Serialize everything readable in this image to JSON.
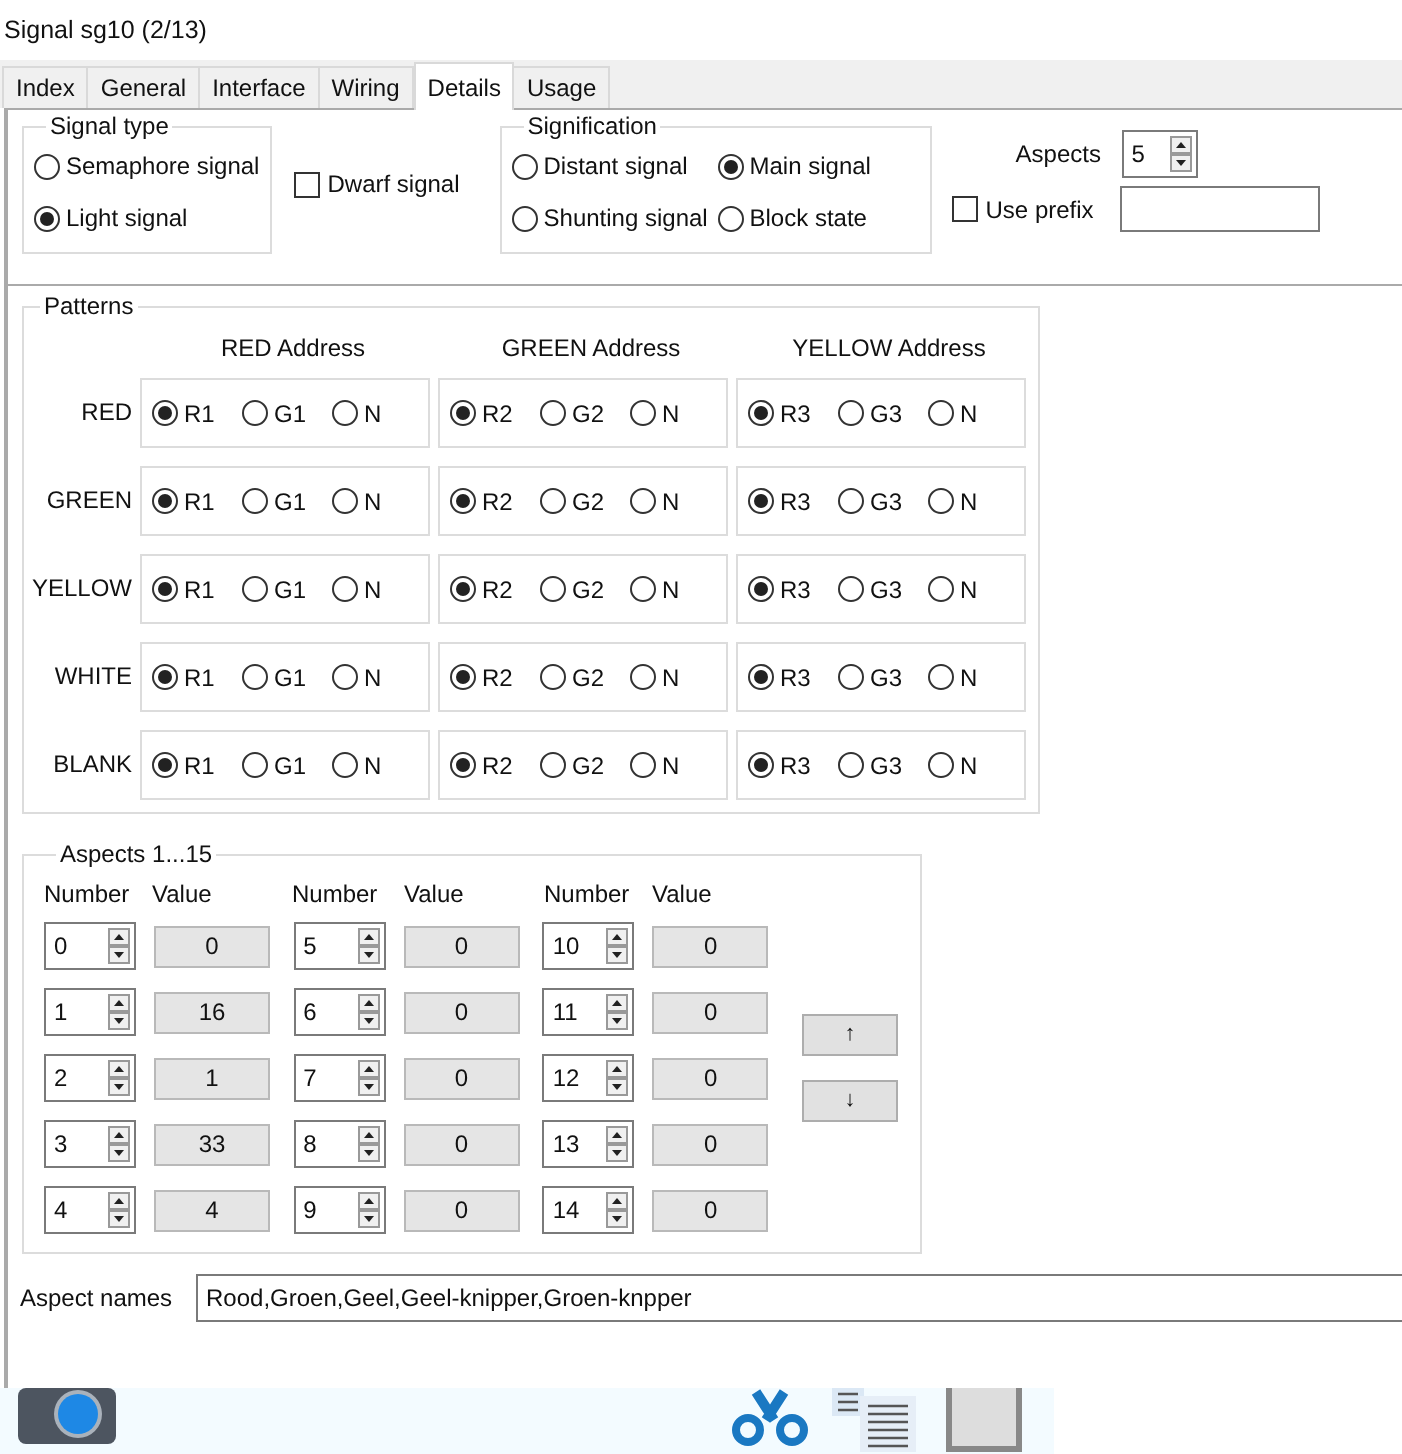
{
  "window": {
    "title": "Signal sg10 (2/13)"
  },
  "tabs": [
    {
      "label": "Index",
      "selected": false
    },
    {
      "label": "General",
      "selected": false
    },
    {
      "label": "Interface",
      "selected": false
    },
    {
      "label": "Wiring",
      "selected": false
    },
    {
      "label": "Details",
      "selected": true
    },
    {
      "label": "Usage",
      "selected": false
    }
  ],
  "signal_type": {
    "title": "Signal type",
    "options": [
      {
        "label": "Semaphore signal",
        "selected": false
      },
      {
        "label": "Light signal",
        "selected": true
      }
    ]
  },
  "dwarf_signal": {
    "label": "Dwarf signal",
    "checked": false
  },
  "signification": {
    "title": "Signification",
    "options": [
      {
        "label": "Distant signal",
        "selected": false
      },
      {
        "label": "Main signal",
        "selected": true
      },
      {
        "label": "Shunting signal",
        "selected": false
      },
      {
        "label": "Block state",
        "selected": false
      }
    ]
  },
  "aspects": {
    "label": "Aspects",
    "value": "5"
  },
  "use_prefix": {
    "label": "Use prefix",
    "checked": false
  },
  "patterns": {
    "title": "Patterns",
    "columns": [
      "RED Address",
      "GREEN Address",
      "YELLOW Address"
    ],
    "rows": [
      {
        "label": "RED",
        "cells": [
          [
            {
              "label": "R1",
              "selected": true
            },
            {
              "label": "G1",
              "selected": false
            },
            {
              "label": "N",
              "selected": false
            }
          ],
          [
            {
              "label": "R2",
              "selected": true
            },
            {
              "label": "G2",
              "selected": false
            },
            {
              "label": "N",
              "selected": false
            }
          ],
          [
            {
              "label": "R3",
              "selected": true
            },
            {
              "label": "G3",
              "selected": false
            },
            {
              "label": "N",
              "selected": false
            }
          ]
        ]
      },
      {
        "label": "GREEN",
        "cells": [
          [
            {
              "label": "R1",
              "selected": true
            },
            {
              "label": "G1",
              "selected": false
            },
            {
              "label": "N",
              "selected": false
            }
          ],
          [
            {
              "label": "R2",
              "selected": true
            },
            {
              "label": "G2",
              "selected": false
            },
            {
              "label": "N",
              "selected": false
            }
          ],
          [
            {
              "label": "R3",
              "selected": true
            },
            {
              "label": "G3",
              "selected": false
            },
            {
              "label": "N",
              "selected": false
            }
          ]
        ]
      },
      {
        "label": "YELLOW",
        "cells": [
          [
            {
              "label": "R1",
              "selected": true
            },
            {
              "label": "G1",
              "selected": false
            },
            {
              "label": "N",
              "selected": false
            }
          ],
          [
            {
              "label": "R2",
              "selected": true
            },
            {
              "label": "G2",
              "selected": false
            },
            {
              "label": "N",
              "selected": false
            }
          ],
          [
            {
              "label": "R3",
              "selected": true
            },
            {
              "label": "G3",
              "selected": false
            },
            {
              "label": "N",
              "selected": false
            }
          ]
        ]
      },
      {
        "label": "WHITE",
        "cells": [
          [
            {
              "label": "R1",
              "selected": true
            },
            {
              "label": "G1",
              "selected": false
            },
            {
              "label": "N",
              "selected": false
            }
          ],
          [
            {
              "label": "R2",
              "selected": true
            },
            {
              "label": "G2",
              "selected": false
            },
            {
              "label": "N",
              "selected": false
            }
          ],
          [
            {
              "label": "R3",
              "selected": true
            },
            {
              "label": "G3",
              "selected": false
            },
            {
              "label": "N",
              "selected": false
            }
          ]
        ]
      },
      {
        "label": "BLANK",
        "cells": [
          [
            {
              "label": "R1",
              "selected": true
            },
            {
              "label": "G1",
              "selected": false
            },
            {
              "label": "N",
              "selected": false
            }
          ],
          [
            {
              "label": "R2",
              "selected": true
            },
            {
              "label": "G2",
              "selected": false
            },
            {
              "label": "N",
              "selected": false
            }
          ],
          [
            {
              "label": "R3",
              "selected": true
            },
            {
              "label": "G3",
              "selected": false
            },
            {
              "label": "N",
              "selected": false
            }
          ]
        ]
      }
    ]
  },
  "aspect_table": {
    "title": "Aspects 1...15",
    "headers": [
      "Number",
      "Value",
      "Number",
      "Value",
      "Number",
      "Value"
    ],
    "entries": [
      {
        "number": "0",
        "value": "0"
      },
      {
        "number": "1",
        "value": "16"
      },
      {
        "number": "2",
        "value": "1"
      },
      {
        "number": "3",
        "value": "33"
      },
      {
        "number": "4",
        "value": "4"
      },
      {
        "number": "5",
        "value": "0"
      },
      {
        "number": "6",
        "value": "0"
      },
      {
        "number": "7",
        "value": "0"
      },
      {
        "number": "8",
        "value": "0"
      },
      {
        "number": "9",
        "value": "0"
      },
      {
        "number": "10",
        "value": "0"
      },
      {
        "number": "11",
        "value": "0"
      },
      {
        "number": "12",
        "value": "0"
      },
      {
        "number": "13",
        "value": "0"
      },
      {
        "number": "14",
        "value": "0"
      }
    ],
    "buttons": [
      "↑",
      "↓"
    ]
  },
  "aspect_names": {
    "label": "Aspect names",
    "value": "Rood,Groen,Geel,Geel-knipper,Groen-knpper"
  }
}
